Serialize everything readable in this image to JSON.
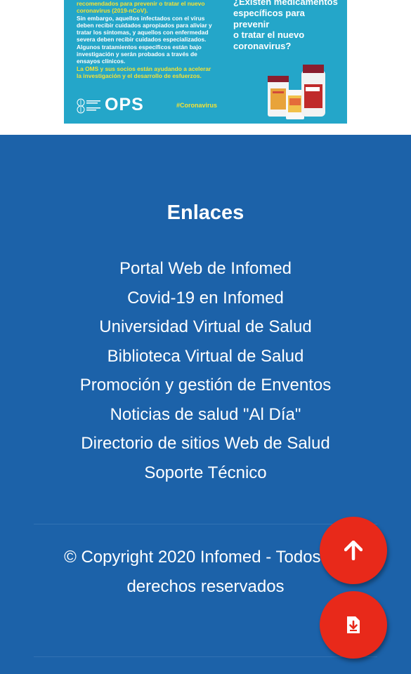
{
  "banner": {
    "left_lines": [
      {
        "text": "recomendados para prevenir o tratar el nuevo",
        "color": "yellow"
      },
      {
        "text": "coronavirus (2019-nCoV).",
        "color": "yellow"
      },
      {
        "text": "Sin embargo, aquellos infectados con el virus",
        "color": "white"
      },
      {
        "text": "deben recibir cuidados apropiados para aliviar y",
        "color": "white"
      },
      {
        "text": "tratar los síntomas, y aquellos con enfermedad",
        "color": "white"
      },
      {
        "text": "severa deben recibir cuidados especializados.",
        "color": "white"
      },
      {
        "text": "Algunos tratamientos específicos están bajo",
        "color": "white"
      },
      {
        "text": "investigación y serán probados a través de",
        "color": "white"
      },
      {
        "text": "ensayos clínicos.",
        "color": "white"
      },
      {
        "text": "La OMS y sus socios están ayudando a acelerar",
        "color": "yellow"
      },
      {
        "text": "la investigación y el desarrollo de esfuerzos.",
        "color": "yellow"
      }
    ],
    "right_lines": [
      "¿Existen medicamentos",
      "específicos para",
      "prevenir",
      "o tratar el nuevo",
      "coronavirus?"
    ],
    "logo_text": "OPS",
    "hashtag": "#Coronavirus"
  },
  "footer": {
    "heading": "Enlaces",
    "links": [
      "Portal Web de Infomed",
      "Covid-19 en Infomed",
      "Universidad Virtual de Salud",
      "Biblioteca Virtual de Salud",
      "Promoción y gestión de Enventos",
      "Noticias de salud \"Al Día\"",
      "Directorio de sitios Web de Salud",
      "Soporte Técnico"
    ],
    "copyright_line1": "© Copyright 2020 Infomed - Todos los",
    "copyright_line2": "derechos reservados"
  },
  "fabs": {
    "scroll_top_icon": "arrow-up-icon",
    "download_icon": "file-download-icon"
  },
  "colors": {
    "footer_bg": "#1c62a9",
    "banner_bg": "#24a6c9",
    "banner_yellow": "#f7e232",
    "fab_red": "#e8291a"
  }
}
